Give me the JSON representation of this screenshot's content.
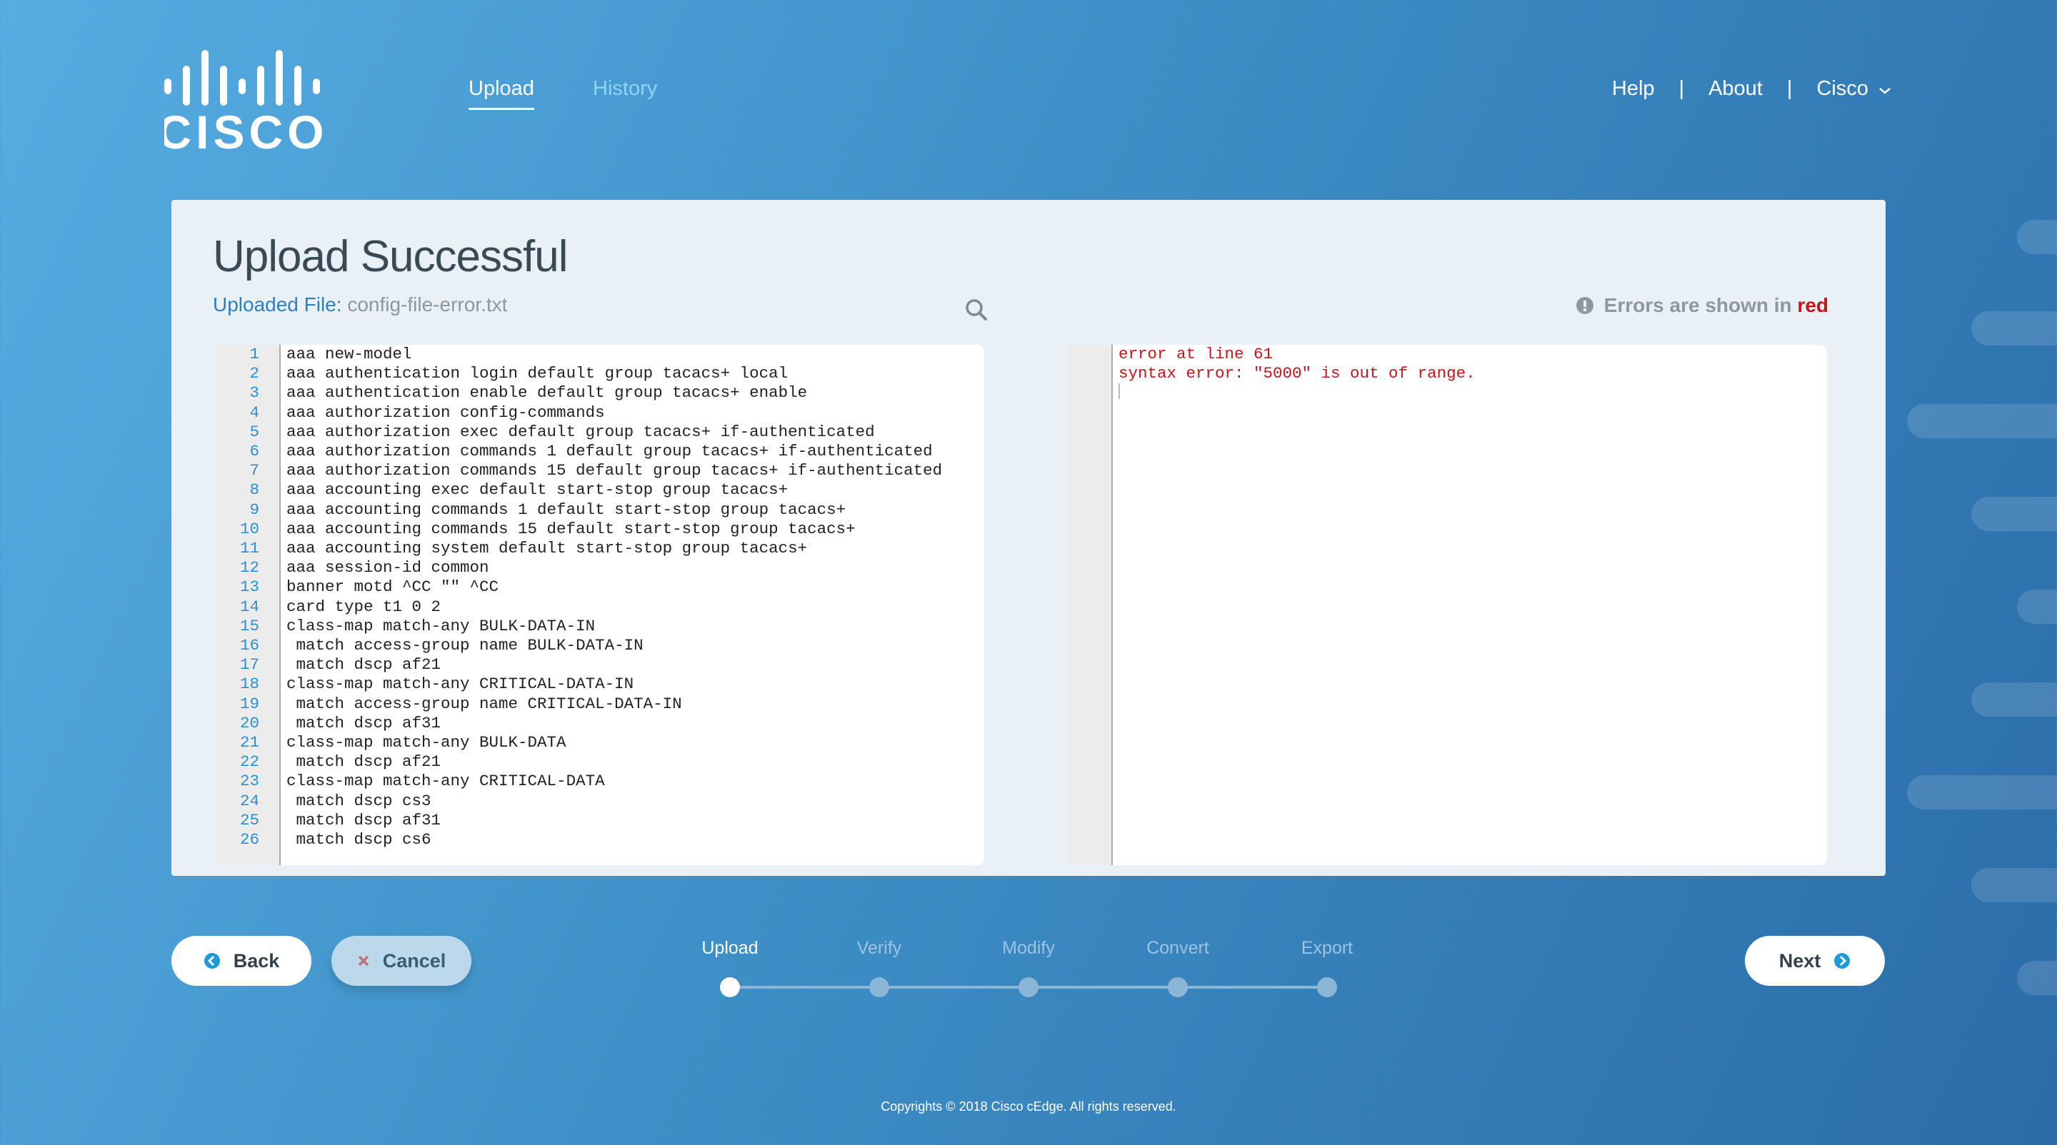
{
  "brand": {
    "logo_text": "cisco"
  },
  "nav": {
    "tabs": [
      {
        "label": "Upload",
        "active": true
      },
      {
        "label": "History",
        "active": false
      }
    ]
  },
  "topright": {
    "help": "Help",
    "sep": "|",
    "about": "About",
    "account": "Cisco"
  },
  "panel": {
    "title": "Upload Successful",
    "uploaded_label": "Uploaded File:",
    "file_name": "config-file-error.txt",
    "error_note_prefix": "Errors are shown in",
    "error_note_red": "red"
  },
  "editor_left": {
    "lines": [
      "aaa new-model",
      "aaa authentication login default group tacacs+ local",
      "aaa authentication enable default group tacacs+ enable",
      "aaa authorization config-commands",
      "aaa authorization exec default group tacacs+ if-authenticated",
      "aaa authorization commands 1 default group tacacs+ if-authenticated",
      "aaa authorization commands 15 default group tacacs+ if-authenticated",
      "aaa accounting exec default start-stop group tacacs+",
      "aaa accounting commands 1 default start-stop group tacacs+",
      "aaa accounting commands 15 default start-stop group tacacs+",
      "aaa accounting system default start-stop group tacacs+",
      "aaa session-id common",
      "banner motd ^CC \"\" ^CC",
      "card type t1 0 2",
      "class-map match-any BULK-DATA-IN",
      " match access-group name BULK-DATA-IN",
      " match dscp af21",
      "class-map match-any CRITICAL-DATA-IN",
      " match access-group name CRITICAL-DATA-IN",
      " match dscp af31",
      "class-map match-any BULK-DATA",
      " match dscp af21",
      "class-map match-any CRITICAL-DATA",
      " match dscp cs3",
      " match dscp af31",
      " match dscp cs6"
    ]
  },
  "editor_right": {
    "lines": [
      "error at line 61",
      "syntax error: \"5000\" is out of range."
    ]
  },
  "buttons": {
    "back": "Back",
    "cancel": "Cancel",
    "next": "Next"
  },
  "steps": [
    {
      "label": "Upload",
      "active": true
    },
    {
      "label": "Verify"
    },
    {
      "label": "Modify"
    },
    {
      "label": "Convert"
    },
    {
      "label": "Export"
    }
  ],
  "footer": {
    "copyright": "Copyrights © 2018 Cisco cEdge. All rights reserved."
  },
  "colors": {
    "accent": "#2d7fc0",
    "error": "#c4161c",
    "panel": "#e9f1f6"
  }
}
